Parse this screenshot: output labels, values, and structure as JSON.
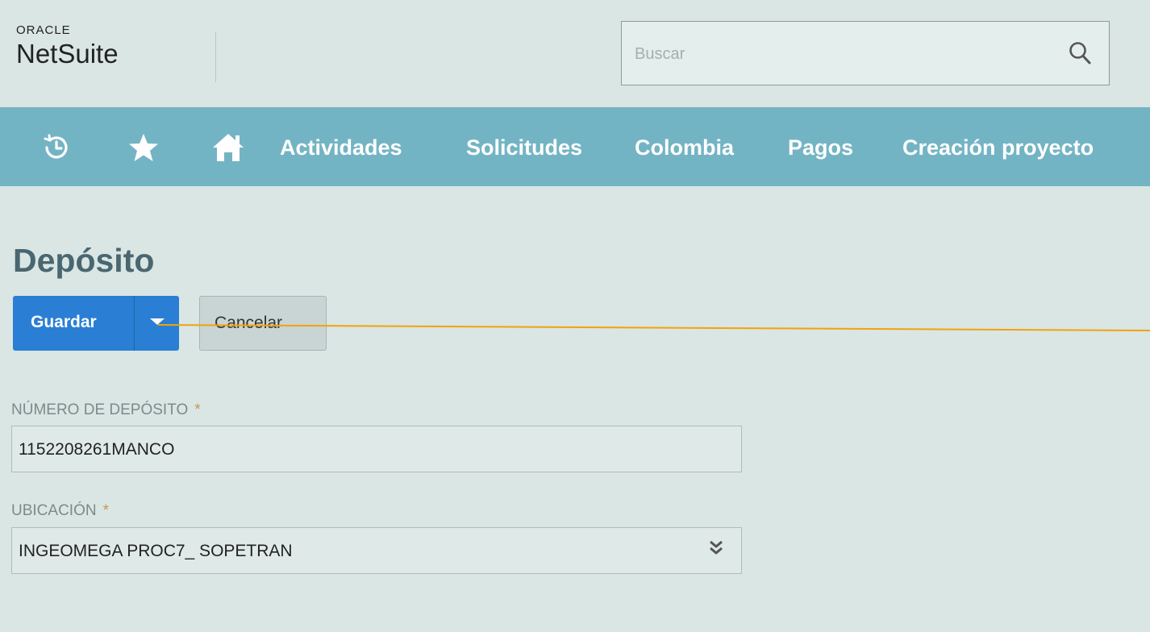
{
  "brand": {
    "oracle": "ORACLE",
    "netsuite": "NetSuite"
  },
  "search": {
    "placeholder": "Buscar",
    "icon": "search-icon"
  },
  "nav": {
    "icons": [
      "recent-history-icon",
      "star-icon",
      "home-icon"
    ],
    "items": [
      {
        "label": "Actividades"
      },
      {
        "label": "Solicitudes"
      },
      {
        "label": "Colombia"
      },
      {
        "label": "Pagos"
      },
      {
        "label": "Creación proyecto"
      }
    ]
  },
  "page": {
    "title": "Depósito"
  },
  "actions": {
    "save_label": "Guardar",
    "cancel_label": "Cancelar"
  },
  "form": {
    "deposit_number": {
      "label": "NÚMERO DE DEPÓSITO",
      "required_mark": "*",
      "value": "1152208261MANCO"
    },
    "location": {
      "label": "UBICACIÓN",
      "required_mark": "*",
      "value": "INGEOMEGA PROC7_ SOPETRAN"
    }
  },
  "colors": {
    "background": "#d9e6e3",
    "nav_bar": "#73b4c4",
    "primary_button": "#2a7fd4",
    "title": "#4a6670",
    "required_mark": "#c29a4e",
    "annotation_line": "#f2a20c"
  }
}
